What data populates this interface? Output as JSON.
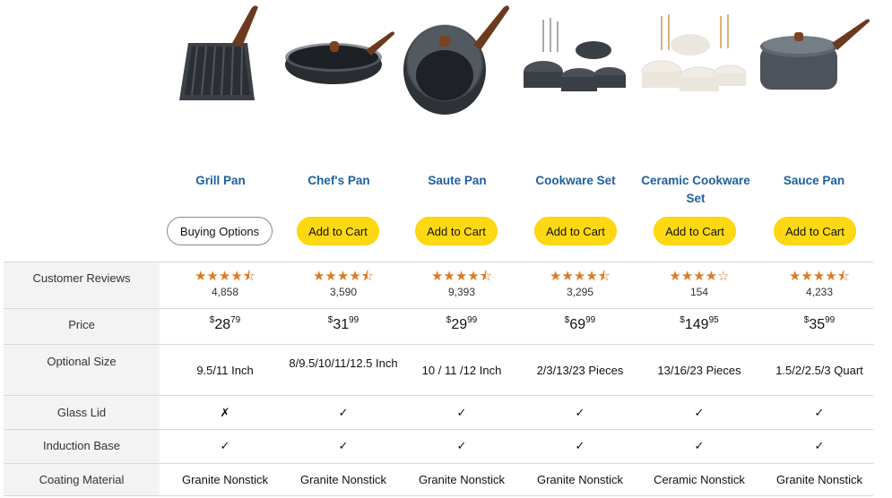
{
  "products": [
    {
      "name": "Grill Pan",
      "button": "Buying Options",
      "button_type": "options",
      "rating": 4.5,
      "reviews": "4,858",
      "price_whole": "28",
      "price_frac": "79",
      "price_symbol": "$",
      "size": "9.5/11 Inch",
      "glass_lid": "✗",
      "induction": "✓",
      "coating": "Granite Nonstick",
      "image": "grill-pan-image"
    },
    {
      "name": "Chef's Pan",
      "button": "Add to Cart",
      "button_type": "cart",
      "rating": 4.5,
      "reviews": "3,590",
      "price_whole": "31",
      "price_frac": "99",
      "price_symbol": "$",
      "size": "8/9.5/10/11/12.5 Inch",
      "glass_lid": "✓",
      "induction": "✓",
      "coating": "Granite Nonstick",
      "image": "chefs-pan-image"
    },
    {
      "name": "Saute Pan",
      "button": "Add to Cart",
      "button_type": "cart",
      "rating": 4.5,
      "reviews": "9,393",
      "price_whole": "29",
      "price_frac": "99",
      "price_symbol": "$",
      "size": "10 / 11 /12 Inch",
      "glass_lid": "✓",
      "induction": "✓",
      "coating": "Granite Nonstick",
      "image": "saute-pan-image"
    },
    {
      "name": "Cookware Set",
      "button": "Add to Cart",
      "button_type": "cart",
      "rating": 4.5,
      "reviews": "3,295",
      "price_whole": "69",
      "price_frac": "99",
      "price_symbol": "$",
      "size": "2/3/13/23 Pieces",
      "glass_lid": "✓",
      "induction": "✓",
      "coating": "Granite Nonstick",
      "image": "cookware-set-image"
    },
    {
      "name": "Ceramic Cookware Set",
      "button": "Add to Cart",
      "button_type": "cart",
      "rating": 4.0,
      "reviews": "154",
      "price_whole": "149",
      "price_frac": "95",
      "price_symbol": "$",
      "size": "13/16/23 Pieces",
      "glass_lid": "✓",
      "induction": "✓",
      "coating": "Ceramic Nonstick",
      "image": "ceramic-set-image"
    },
    {
      "name": "Sauce Pan",
      "button": "Add to Cart",
      "button_type": "cart",
      "rating": 4.5,
      "reviews": "4,233",
      "price_whole": "35",
      "price_frac": "99",
      "price_symbol": "$",
      "size": "1.5/2/2.5/3 Quart",
      "glass_lid": "✓",
      "induction": "✓",
      "coating": "Granite Nonstick",
      "image": "sauce-pan-image"
    }
  ],
  "row_labels": {
    "reviews": "Customer Reviews",
    "price": "Price",
    "size": "Optional Size",
    "glass_lid": "Glass Lid",
    "induction": "Induction Base",
    "coating": "Coating Material"
  },
  "colors": {
    "link": "#1f5f9e",
    "cart_button": "#ffd814",
    "star": "#de7921",
    "label_bg": "#f3f3f3"
  }
}
